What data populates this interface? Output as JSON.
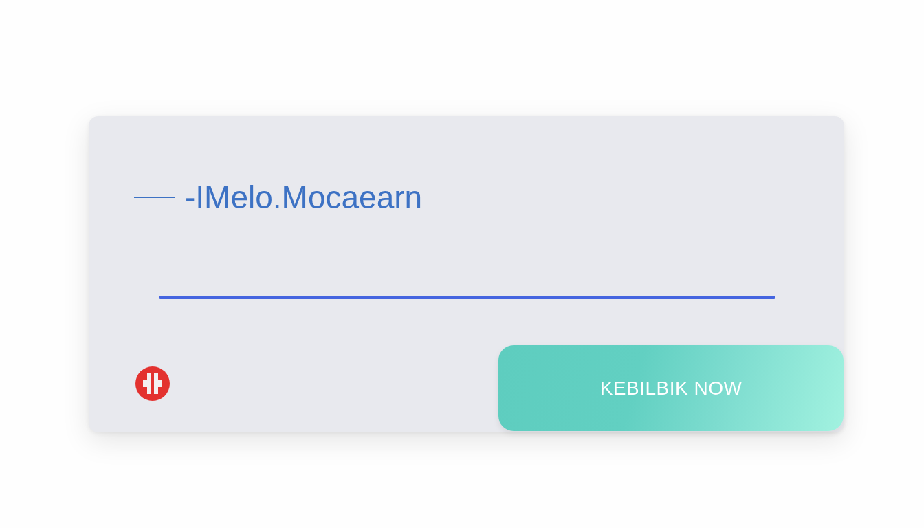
{
  "card": {
    "title": "-IMelo.Mocaearn",
    "field": {
      "focused": true
    },
    "button": {
      "label": "KEBILBIK NOW"
    }
  }
}
